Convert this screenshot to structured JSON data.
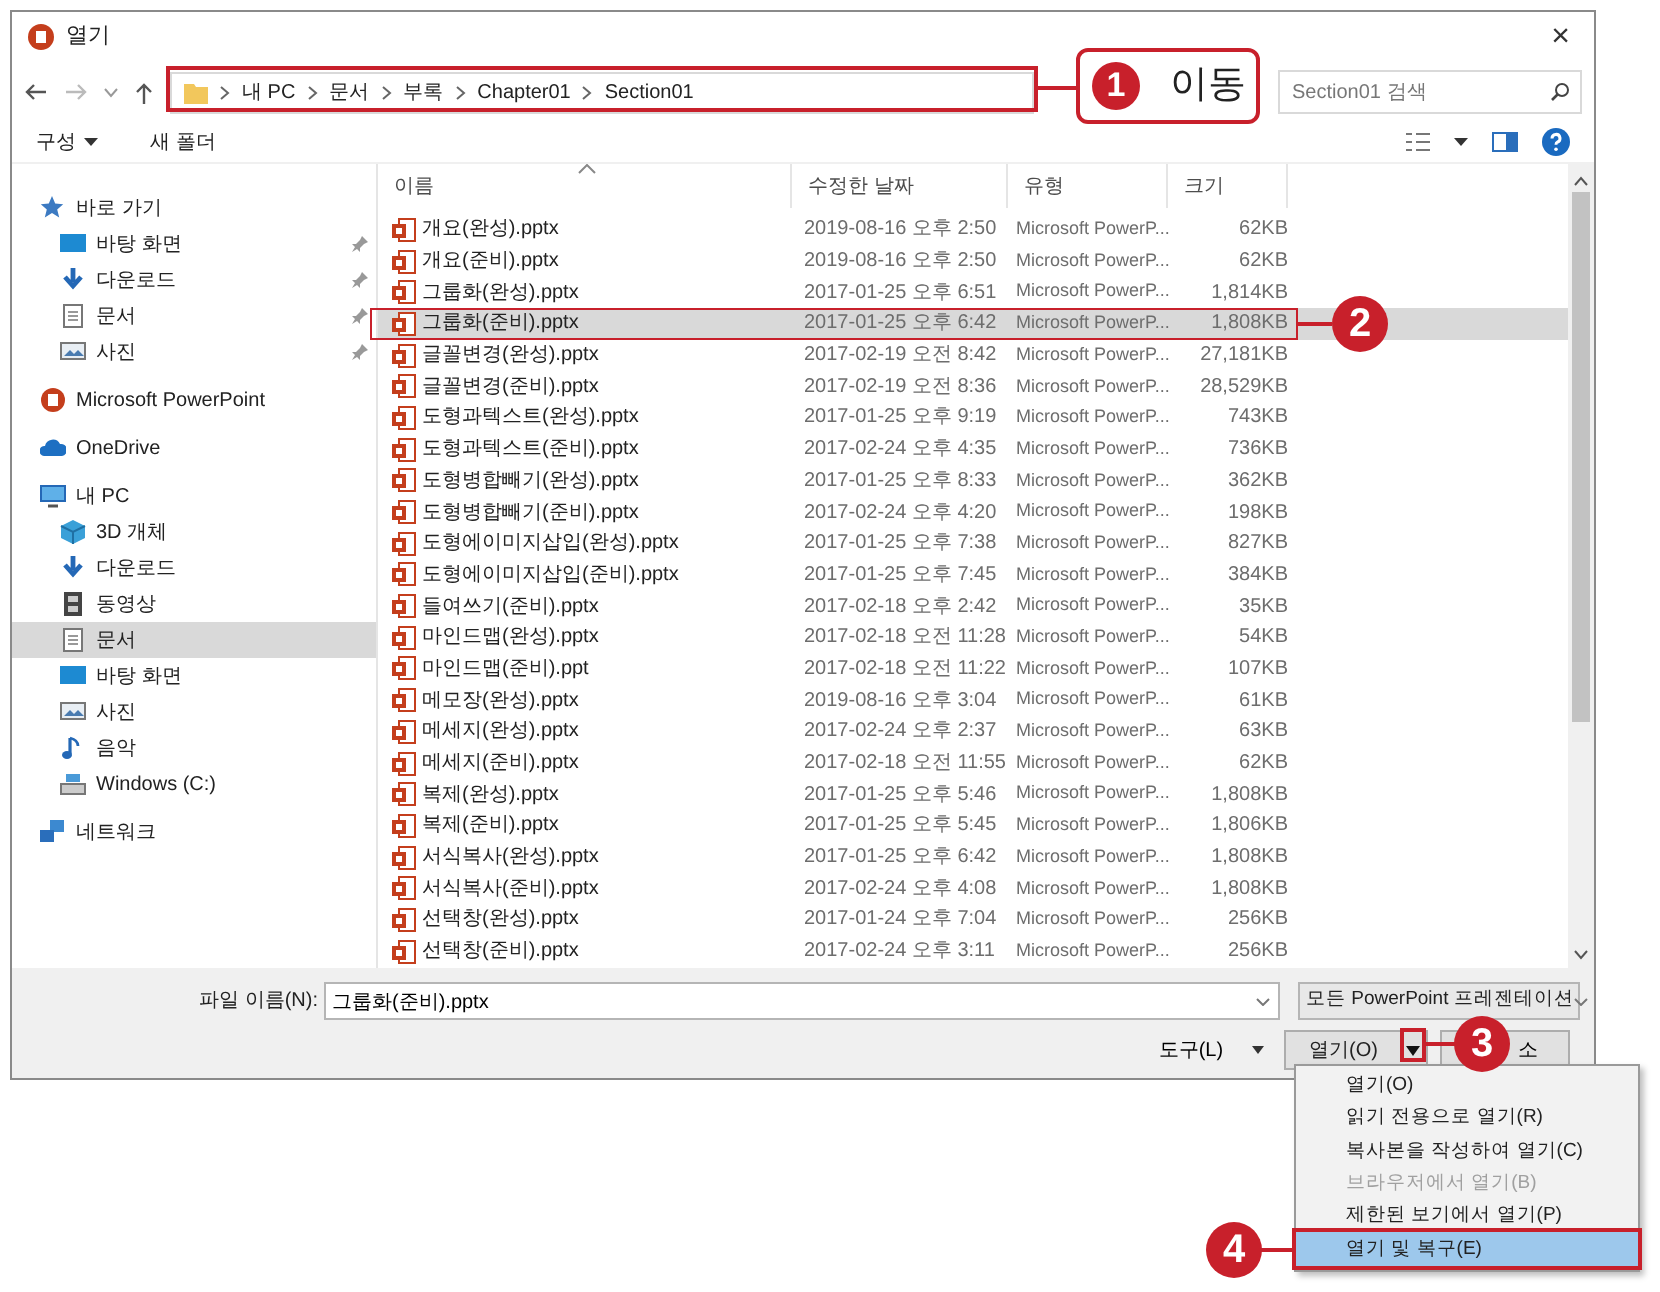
{
  "window": {
    "title": "열기",
    "close": "×"
  },
  "address": {
    "segments": [
      "내 PC",
      "문서",
      "부록",
      "Chapter01",
      "Section01"
    ]
  },
  "search": {
    "placeholder": "Section01 검색"
  },
  "toolbar": {
    "organize": "구성",
    "new_folder": "새 폴더"
  },
  "sidebar": {
    "items": [
      {
        "label": "바로 가기",
        "selected": false,
        "children": [
          {
            "label": "바탕 화면",
            "pinned": true,
            "selected": false
          },
          {
            "label": "다운로드",
            "pinned": true,
            "selected": false
          },
          {
            "label": "문서",
            "pinned": true,
            "selected": false
          },
          {
            "label": "사진",
            "pinned": true,
            "selected": false
          }
        ]
      },
      {
        "label": "Microsoft PowerPoint",
        "selected": false
      },
      {
        "label": "OneDrive",
        "selected": false
      },
      {
        "label": "내 PC",
        "selected": false,
        "children": [
          {
            "label": "3D 개체",
            "selected": false
          },
          {
            "label": "다운로드",
            "selected": false
          },
          {
            "label": "동영상",
            "selected": false
          },
          {
            "label": "문서",
            "selected": true
          },
          {
            "label": "바탕 화면",
            "selected": false
          },
          {
            "label": "사진",
            "selected": false
          },
          {
            "label": "음악",
            "selected": false
          },
          {
            "label": "Windows (C:)",
            "selected": false
          }
        ]
      },
      {
        "label": "네트워크",
        "selected": false
      }
    ]
  },
  "table": {
    "columns": [
      {
        "label": "이름",
        "sorted": true
      },
      {
        "label": "수정한 날짜",
        "sorted": false
      },
      {
        "label": "유형",
        "sorted": false
      },
      {
        "label": "크기",
        "sorted": false
      }
    ],
    "rows": [
      {
        "name": "개요(완성).pptx",
        "date": "2019-08-16 오후 2:50",
        "type": "Microsoft PowerP...",
        "size": "62KB",
        "selected": false
      },
      {
        "name": "개요(준비).pptx",
        "date": "2019-08-16 오후 2:50",
        "type": "Microsoft PowerP...",
        "size": "62KB",
        "selected": false
      },
      {
        "name": "그룹화(완성).pptx",
        "date": "2017-01-25 오후 6:51",
        "type": "Microsoft PowerP...",
        "size": "1,814KB",
        "selected": false
      },
      {
        "name": "그룹화(준비).pptx",
        "date": "2017-01-25 오후 6:42",
        "type": "Microsoft PowerP...",
        "size": "1,808KB",
        "selected": true
      },
      {
        "name": "글꼴변경(완성).pptx",
        "date": "2017-02-19 오전 8:42",
        "type": "Microsoft PowerP...",
        "size": "27,181KB",
        "selected": false
      },
      {
        "name": "글꼴변경(준비).pptx",
        "date": "2017-02-19 오전 8:36",
        "type": "Microsoft PowerP...",
        "size": "28,529KB",
        "selected": false
      },
      {
        "name": "도형과텍스트(완성).pptx",
        "date": "2017-01-25 오후 9:19",
        "type": "Microsoft PowerP...",
        "size": "743KB",
        "selected": false
      },
      {
        "name": "도형과텍스트(준비).pptx",
        "date": "2017-02-24 오후 4:35",
        "type": "Microsoft PowerP...",
        "size": "736KB",
        "selected": false
      },
      {
        "name": "도형병합빼기(완성).pptx",
        "date": "2017-01-25 오후 8:33",
        "type": "Microsoft PowerP...",
        "size": "362KB",
        "selected": false
      },
      {
        "name": "도형병합빼기(준비).pptx",
        "date": "2017-02-24 오후 4:20",
        "type": "Microsoft PowerP...",
        "size": "198KB",
        "selected": false
      },
      {
        "name": "도형에이미지삽입(완성).pptx",
        "date": "2017-01-25 오후 7:38",
        "type": "Microsoft PowerP...",
        "size": "827KB",
        "selected": false
      },
      {
        "name": "도형에이미지삽입(준비).pptx",
        "date": "2017-01-25 오후 7:45",
        "type": "Microsoft PowerP...",
        "size": "384KB",
        "selected": false
      },
      {
        "name": "들여쓰기(준비).pptx",
        "date": "2017-02-18 오후 2:42",
        "type": "Microsoft PowerP...",
        "size": "35KB",
        "selected": false
      },
      {
        "name": "마인드맵(완성).pptx",
        "date": "2017-02-18 오전 11:28",
        "type": "Microsoft PowerP...",
        "size": "54KB",
        "selected": false
      },
      {
        "name": "마인드맵(준비).ppt",
        "date": "2017-02-18 오전 11:22",
        "type": "Microsoft PowerP...",
        "size": "107KB",
        "selected": false
      },
      {
        "name": "메모장(완성).pptx",
        "date": "2019-08-16 오후 3:04",
        "type": "Microsoft PowerP...",
        "size": "61KB",
        "selected": false
      },
      {
        "name": "메세지(완성).pptx",
        "date": "2017-02-24 오후 2:37",
        "type": "Microsoft PowerP...",
        "size": "63KB",
        "selected": false
      },
      {
        "name": "메세지(준비).pptx",
        "date": "2017-02-18 오전 11:55",
        "type": "Microsoft PowerP...",
        "size": "62KB",
        "selected": false
      },
      {
        "name": "복제(완성).pptx",
        "date": "2017-01-25 오후 5:46",
        "type": "Microsoft PowerP...",
        "size": "1,808KB",
        "selected": false
      },
      {
        "name": "복제(준비).pptx",
        "date": "2017-01-25 오후 5:45",
        "type": "Microsoft PowerP...",
        "size": "1,806KB",
        "selected": false
      },
      {
        "name": "서식복사(완성).pptx",
        "date": "2017-01-25 오후 6:42",
        "type": "Microsoft PowerP...",
        "size": "1,808KB",
        "selected": false
      },
      {
        "name": "서식복사(준비).pptx",
        "date": "2017-02-24 오후 4:08",
        "type": "Microsoft PowerP...",
        "size": "1,808KB",
        "selected": false
      },
      {
        "name": "선택창(완성).pptx",
        "date": "2017-01-24 오후 7:04",
        "type": "Microsoft PowerP...",
        "size": "256KB",
        "selected": false
      },
      {
        "name": "선택창(준비).pptx",
        "date": "2017-02-24 오후 3:11",
        "type": "Microsoft PowerP...",
        "size": "256KB",
        "selected": false
      }
    ]
  },
  "footer": {
    "file_name_label": "파일 이름(N):",
    "file_name": "그룹화(준비).pptx",
    "file_type": "모든 PowerPoint 프레젠테이션",
    "tools": "도구(L)",
    "open": "열기(O)",
    "cancel": "소"
  },
  "open_menu": {
    "items": [
      {
        "label": "열기(O)",
        "disabled": false,
        "selected": false
      },
      {
        "label": "읽기 전용으로 열기(R)",
        "disabled": false,
        "selected": false
      },
      {
        "label": "복사본을 작성하여 열기(C)",
        "disabled": false,
        "selected": false
      },
      {
        "label": "브라우저에서 열기(B)",
        "disabled": true,
        "selected": false
      },
      {
        "label": "제한된 보기에서 열기(P)",
        "disabled": false,
        "selected": false
      },
      {
        "label": "열기 및 복구(E)",
        "disabled": false,
        "selected": true
      }
    ]
  },
  "callouts": [
    {
      "number": "1",
      "label": "이동"
    },
    {
      "number": "2"
    },
    {
      "number": "3"
    },
    {
      "number": "4"
    }
  ]
}
